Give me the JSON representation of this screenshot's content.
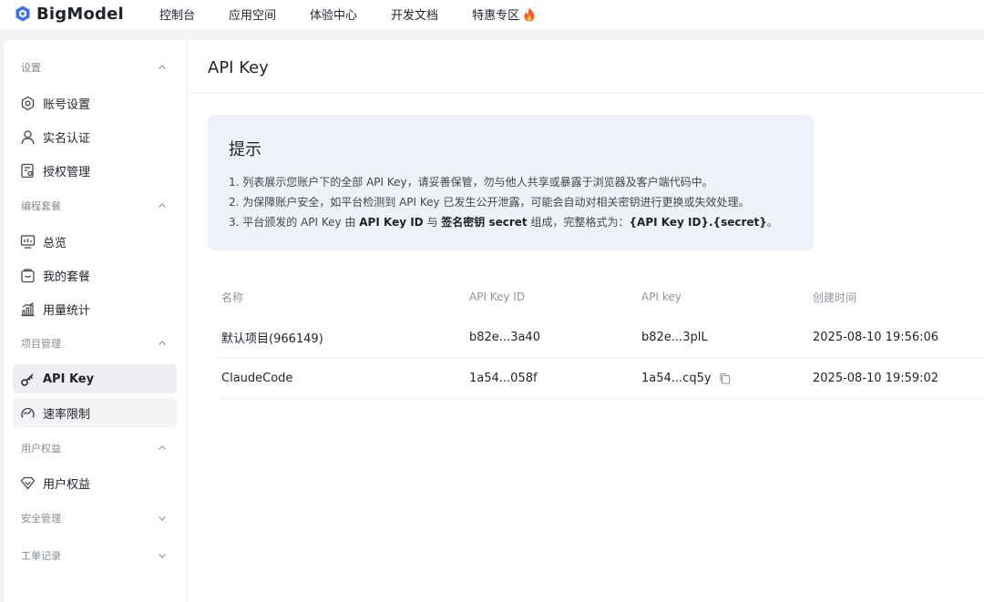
{
  "brand": {
    "name": "BigModel"
  },
  "nav": [
    {
      "label": "控制台"
    },
    {
      "label": "应用空间"
    },
    {
      "label": "体验中心"
    },
    {
      "label": "开发文档"
    },
    {
      "label": "特惠专区"
    }
  ],
  "sidebar": {
    "groups": [
      {
        "label": "设置",
        "expanded": true,
        "items": [
          {
            "label": "账号设置",
            "icon": "gear-icon"
          },
          {
            "label": "实名认证",
            "icon": "user-icon"
          },
          {
            "label": "授权管理",
            "icon": "authorization-icon"
          }
        ]
      },
      {
        "label": "编程套餐",
        "expanded": true,
        "items": [
          {
            "label": "总览",
            "icon": "monitor-icon"
          },
          {
            "label": "我的套餐",
            "icon": "package-icon"
          },
          {
            "label": "用量统计",
            "icon": "bar-chart-icon"
          }
        ]
      },
      {
        "label": "项目管理",
        "expanded": true,
        "items": [
          {
            "label": "API Key",
            "icon": "key-icon",
            "active": true
          },
          {
            "label": "速率限制",
            "icon": "speedometer-icon"
          }
        ]
      },
      {
        "label": "用户权益",
        "expanded": true,
        "items": [
          {
            "label": "用户权益",
            "icon": "benefit-icon"
          }
        ]
      },
      {
        "label": "安全管理",
        "expanded": false,
        "items": []
      },
      {
        "label": "工单记录",
        "expanded": false,
        "items": []
      }
    ]
  },
  "page": {
    "title": "API Key"
  },
  "notice": {
    "title": "提示",
    "line1": "1. 列表展示您账户下的全部 API Key，请妥善保管，勿与他人共享或暴露于浏览器及客户端代码中。",
    "line2": "2. 为保障账户安全，如平台检测到 API Key 已发生公开泄露，可能会自动对相关密钥进行更换或失效处理。",
    "line3_a": "3. 平台颁发的 API Key 由 ",
    "line3_b": "API Key ID",
    "line3_c": " 与 ",
    "line3_d": "签名密钥 secret",
    "line3_e": " 组成，完整格式为：",
    "line3_f": "{API Key ID}.{secret}",
    "line3_g": "。"
  },
  "table": {
    "columns": [
      "名称",
      "API Key ID",
      "API key",
      "创建时间"
    ],
    "rows": [
      {
        "name": "默认项目(966149)",
        "key_id": "b82e...3a40",
        "api_key": "b82e...3plL",
        "created": "2025-08-10 19:56:06"
      },
      {
        "name": "ClaudeCode",
        "key_id": "1a54...058f",
        "api_key": "1a54...cq5y",
        "created": "2025-08-10 19:59:02"
      }
    ]
  },
  "colors": {
    "accent": "#3a6ff7",
    "fire": "#ff5a1f",
    "active_bg": "#eceef2",
    "notice_bg": "#eef1f9"
  }
}
